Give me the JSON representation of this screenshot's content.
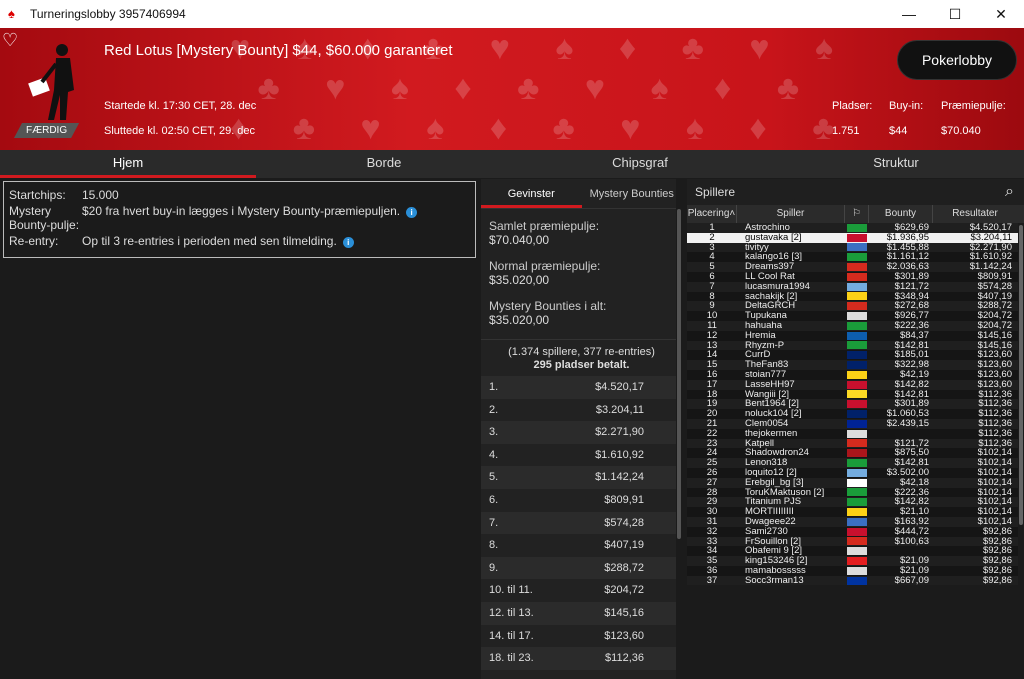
{
  "window": {
    "title": "Turneringslobby 3957406994"
  },
  "hero": {
    "tournament": "Red Lotus [Mystery Bounty] $44, $60.000 garanteret",
    "started": "Startede kl. 17:30 CET, 28. dec",
    "ended": "Sluttede kl. 02:50 CET, 29. dec",
    "status_badge": "FÆRDIG",
    "lobby_button": "Pokerlobby",
    "stats": {
      "seats_label": "Pladser:",
      "seats": "1.751",
      "buyin_label": "Buy-in:",
      "buyin": "$44",
      "prize_label": "Præmiepulje:",
      "prize": "$70.040"
    }
  },
  "tabs": [
    "Hjem",
    "Borde",
    "Chipsgraf",
    "Struktur"
  ],
  "info": {
    "startchips_label": "Startchips:",
    "startchips": "15.000",
    "mystery_label": "Mystery Bounty-pulje:",
    "mystery": "$20 fra hvert buy-in lægges i Mystery Bounty-præmiepuljen.",
    "reentry_label": "Re-entry:",
    "reentry": "Op til 3 re-entries i perioden med sen tilmelding."
  },
  "mid": {
    "tab_winnings": "Gevinster",
    "tab_mystery": "Mystery Bounties",
    "total_label": "Samlet præmiepulje:",
    "total": "$70.040,00",
    "normal_label": "Normal præmiepulje:",
    "normal": "$35.020,00",
    "mystery_label": "Mystery Bounties i alt:",
    "mystery": "$35.020,00",
    "note1": "(1.374 spillere, 377 re-entries)",
    "note2": "295 pladser betalt.",
    "payouts": [
      [
        "1.",
        "$4.520,17"
      ],
      [
        "2.",
        "$3.204,11"
      ],
      [
        "3.",
        "$2.271,90"
      ],
      [
        "4.",
        "$1.610,92"
      ],
      [
        "5.",
        "$1.142,24"
      ],
      [
        "6.",
        "$809,91"
      ],
      [
        "7.",
        "$574,28"
      ],
      [
        "8.",
        "$407,19"
      ],
      [
        "9.",
        "$288,72"
      ],
      [
        "10. til 11.",
        "$204,72"
      ],
      [
        "12. til 13.",
        "$145,16"
      ],
      [
        "14. til 17.",
        "$123,60"
      ],
      [
        "18. til 23.",
        "$112,36"
      ]
    ]
  },
  "players": {
    "header": "Spillere",
    "cols": {
      "place": "Placering",
      "player": "Spiller",
      "bounty": "Bounty",
      "result": "Resultater"
    },
    "rows": [
      [
        "1",
        "Astrochino",
        "#1a9c3a",
        "$629,69",
        "$4.520,17"
      ],
      [
        "2",
        "gustavaka [2]",
        "#c8102e",
        "$1.936,95",
        "$3.204,11"
      ],
      [
        "3",
        "tivityy",
        "#3b6fc2",
        "$1.455,88",
        "$2.271,90"
      ],
      [
        "4",
        "kalango16 [3]",
        "#1a9c3a",
        "$1.161,12",
        "$1.610,92"
      ],
      [
        "5",
        "Dreams397",
        "#d52b1e",
        "$2.036,63",
        "$1.142,24"
      ],
      [
        "6",
        "LL Cool Rat",
        "#d52b1e",
        "$301,89",
        "$809,91"
      ],
      [
        "7",
        "lucasmura1994",
        "#74acdf",
        "$121,72",
        "$574,28"
      ],
      [
        "8",
        "sachakijk [2]",
        "#fcd116",
        "$348,94",
        "$407,19"
      ],
      [
        "9",
        "DeltaGRCH",
        "#d52b1e",
        "$272,68",
        "$288,72"
      ],
      [
        "10",
        "Tupukana",
        "#dddddd",
        "$926,77",
        "$204,72"
      ],
      [
        "11",
        "hahuaha",
        "#1a9c3a",
        "$222,36",
        "$204,72"
      ],
      [
        "12",
        "Hremia",
        "#0d5eaf",
        "$84,37",
        "$145,16"
      ],
      [
        "13",
        "Rhyzm-P",
        "#1a9c3a",
        "$142,81",
        "$145,16"
      ],
      [
        "14",
        "CurrD",
        "#012169",
        "$185,01",
        "$123,60"
      ],
      [
        "15",
        "TheFan83",
        "#012169",
        "$322,98",
        "$123,60"
      ],
      [
        "16",
        "stoian777",
        "#fcd116",
        "$42,19",
        "$123,60"
      ],
      [
        "17",
        "LasseHH97",
        "#c8102e",
        "$142,82",
        "$123,60"
      ],
      [
        "18",
        "Wangiii [2]",
        "#fdda24",
        "$142,81",
        "$112,36"
      ],
      [
        "19",
        "Bent1964 [2]",
        "#c8102e",
        "$301,89",
        "$112,36"
      ],
      [
        "20",
        "noluck104 [2]",
        "#012169",
        "$1.060,53",
        "$112,36"
      ],
      [
        "21",
        "Clem0054",
        "#002395",
        "$2.439,15",
        "$112,36"
      ],
      [
        "22",
        "thejokermen",
        "#dddddd",
        "",
        "$112,36"
      ],
      [
        "23",
        "Katpell",
        "#d52b1e",
        "$121,72",
        "$112,36"
      ],
      [
        "24",
        "Shadowdron24",
        "#aa151b",
        "$875,50",
        "$102,14"
      ],
      [
        "25",
        "Lenon318",
        "#1a9c3a",
        "$142,81",
        "$102,14"
      ],
      [
        "26",
        "loquito12 [2]",
        "#74acdf",
        "$3.502,00",
        "$102,14"
      ],
      [
        "27",
        "Erebgil_bg [3]",
        "#ffffff",
        "$42,18",
        "$102,14"
      ],
      [
        "28",
        "ToruKMaktuson [2]",
        "#1a9c3a",
        "$222,36",
        "$102,14"
      ],
      [
        "29",
        "Titanium PJS",
        "#1a9c3a",
        "$142,82",
        "$102,14"
      ],
      [
        "30",
        "MORTIIIIIIII",
        "#fcd116",
        "$21,10",
        "$102,14"
      ],
      [
        "31",
        "Dwageee22",
        "#3b6fc2",
        "$163,92",
        "$102,14"
      ],
      [
        "32",
        "Sami2730",
        "#c8102e",
        "$444,72",
        "$92,86"
      ],
      [
        "33",
        "FrSouillon [2]",
        "#d52b1e",
        "$100,63",
        "$92,86"
      ],
      [
        "34",
        "Obafemi 9 [2]",
        "#dddddd",
        "",
        "$92,86"
      ],
      [
        "35",
        "king153246 [2]",
        "#e41e20",
        "$21,09",
        "$92,86"
      ],
      [
        "36",
        "mamabosssss",
        "#dddddd",
        "$21,09",
        "$92,86"
      ],
      [
        "37",
        "Socc3rman13",
        "#0033a0",
        "$667,09",
        "$92,86"
      ]
    ]
  }
}
